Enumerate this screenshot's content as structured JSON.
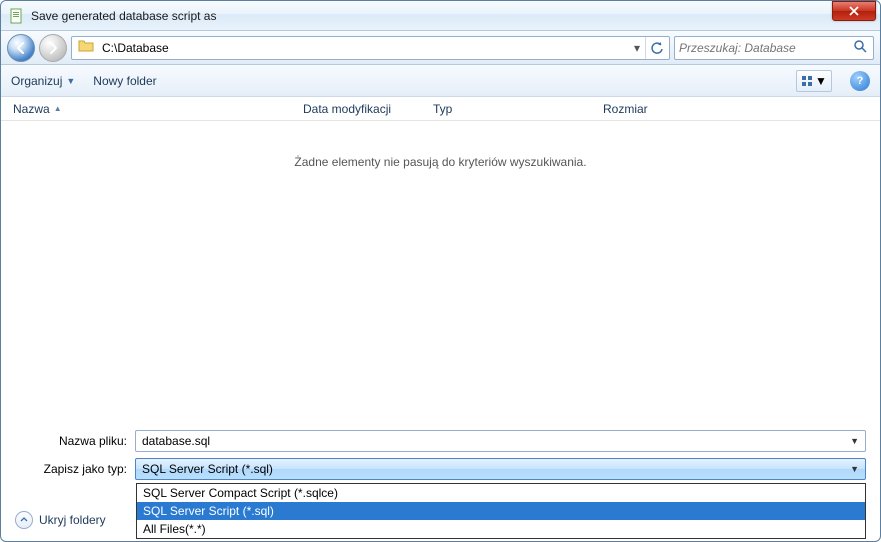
{
  "title": "Save generated database script as",
  "path": "C:\\Database",
  "search_placeholder": "Przeszukaj: Database",
  "toolbar": {
    "organize": "Organizuj",
    "newfolder": "Nowy folder"
  },
  "columns": {
    "name": "Nazwa",
    "modified": "Data modyfikacji",
    "type": "Typ",
    "size": "Rozmiar"
  },
  "empty_message": "Żadne elementy nie pasują do kryteriów wyszukiwania.",
  "form": {
    "filename_label": "Nazwa pliku:",
    "filename_value": "database.sql",
    "savetype_label": "Zapisz jako typ:",
    "savetype_value": "SQL Server Script (*.sql)"
  },
  "filetype_options": [
    "SQL Server Compact Script (*.sqlce)",
    "SQL Server Script (*.sql)",
    "All Files(*.*)"
  ],
  "hide_folders": "Ukryj foldery"
}
